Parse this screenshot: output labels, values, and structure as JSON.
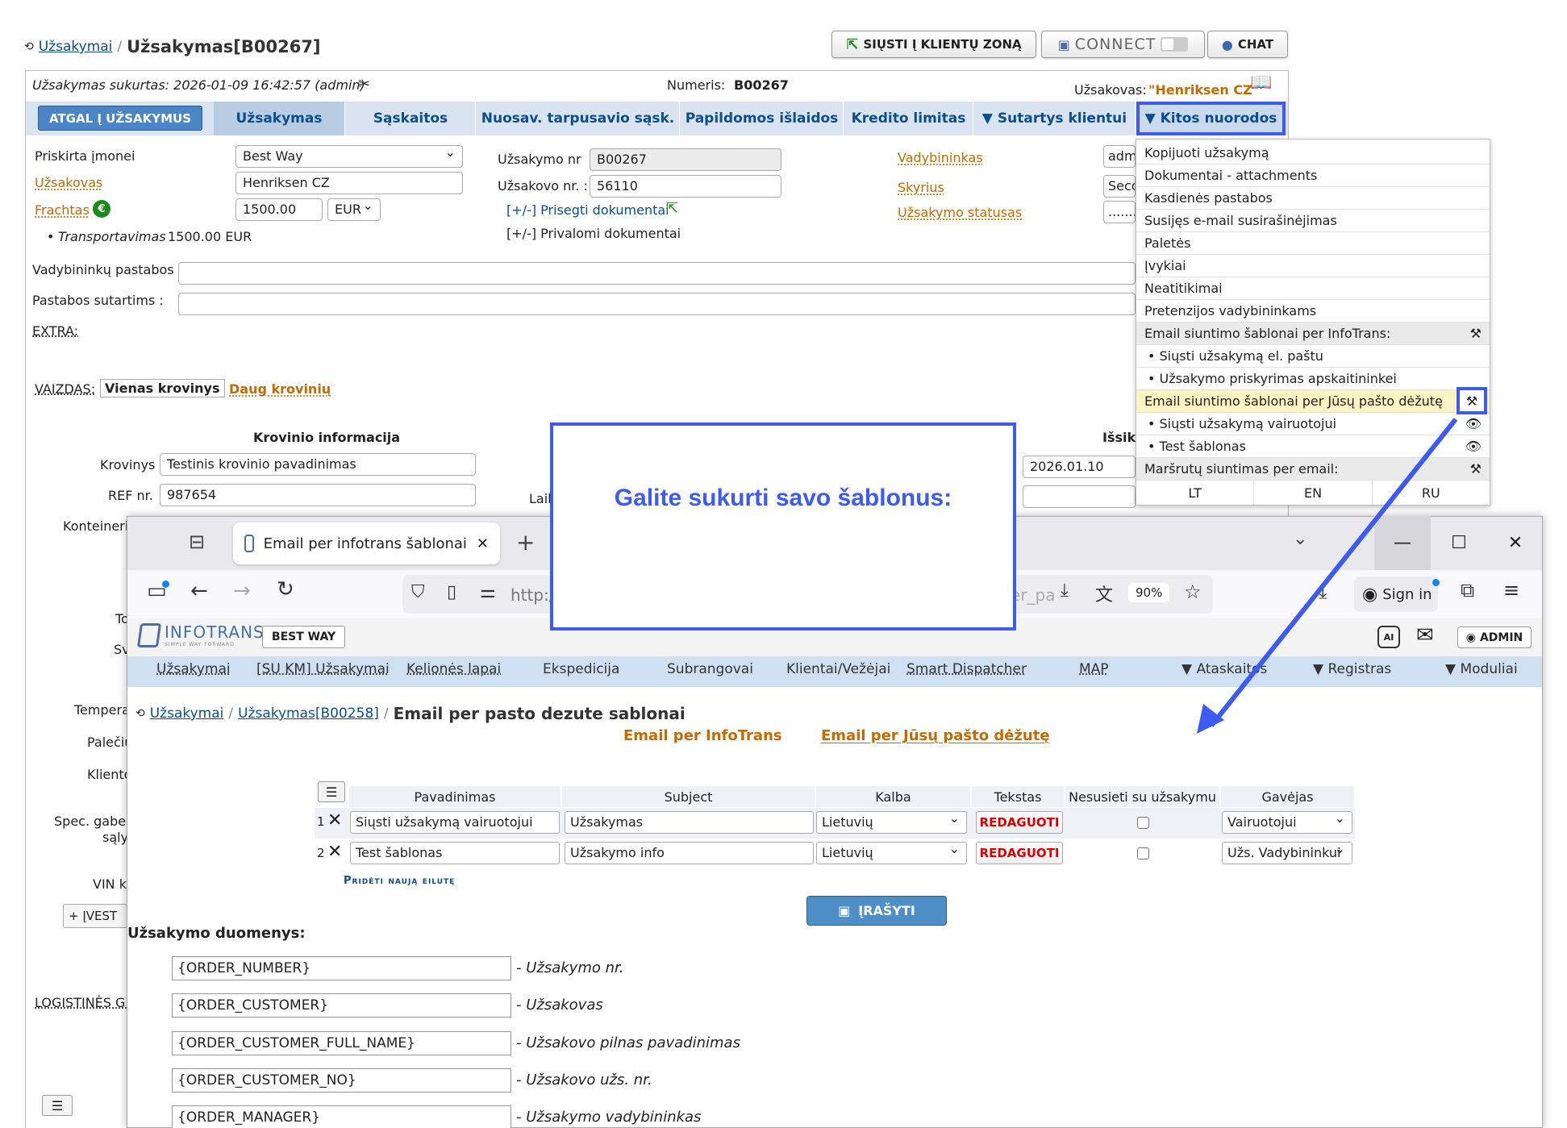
{
  "breadcrumb": {
    "root": "Užsakymai",
    "sep": "/",
    "current": "Užsakymas[B00267]"
  },
  "top_buttons": {
    "send": "SIŲSTI Į KLIENTŲ ZONĄ",
    "connect": "CONNECT",
    "chat": "CHAT"
  },
  "info_bar": {
    "created": "Užsakymas sukurtas: 2026-01-09 16:42:57 (admin)",
    "number_label": "Numeris:",
    "number_value": "B00267",
    "customer_label": "Užsakovas:",
    "customer_value": "\"Henriksen CZ\""
  },
  "tabs": [
    "ATGAL Į UŽSAKYMUS",
    "Užsakymas",
    "Sąskaitos",
    "Nuosav. tarpusavio sąsk.",
    "Papildomos išlaidos",
    "Kredito limitas",
    "▼ Sutartys klientui",
    "▼ Kitos nuorodos"
  ],
  "form": {
    "assigned_label": "Priskirta įmonei",
    "assigned_value": "Best Way",
    "customer_label": "Užsakovas",
    "customer_value": "Henriksen CZ",
    "freight_label": "Frachtas",
    "freight_value": "1500.00",
    "currency": "EUR",
    "transport_label": "Transportavimas",
    "transport_value": "1500.00 EUR",
    "order_nr_label": "Užsakymo nr",
    "order_nr_value": "B00267",
    "cust_nr_label": "Užsakovo nr. :",
    "cust_nr_value": "56110",
    "attach_docs": "[+/-] Prisegti dokumentai",
    "required_docs": "[+/-] Privalomi dokumentai",
    "manager_label": "Vadybininkas",
    "manager_value": "adm",
    "dept_label": "Skyrius",
    "dept_value": "Seco",
    "status_label": "Užsakymo statusas",
    "status_value": "........",
    "mgr_notes_label": "Vadybininkų pastabos :",
    "contract_notes_label": "Pastabos sutartims :",
    "extra_label": "EXTRA:",
    "view_label": "VAIZDAS:",
    "view_single": "Vienas krovinys",
    "view_multi": "Daug krovinių",
    "cargo_header": "Krovinio informacija",
    "cargo_label": "Krovinys",
    "cargo_value": "Testinis krovinio pavadinimas",
    "ref_label": "REF nr.",
    "ref_value": "987654",
    "container_label": "Konteineri",
    "unload_header": "Išsik",
    "unload_date": "2026.01.10",
    "lail": "Lail",
    "side_labels": [
      "To",
      "Sv",
      "Tempera",
      "Palečiu",
      "Kliento",
      "Spec. gaber",
      "sąly",
      "VIN k"
    ],
    "enter_button": "+ ĮVEST",
    "logistics_label": "LOGISTINĖS GI"
  },
  "dropdown": {
    "items": [
      "Kopijuoti užsakymą",
      "Dokumentai - attachments",
      "Kasdienės pastabos",
      "Susijęs e-mail susirašinėjimas",
      "Paletės",
      "Įvykiai",
      "Neatitikimai",
      "Pretenzijos vadybininkams"
    ],
    "section1": "Email siuntimo šablonai per InfoTrans:",
    "section1_items": [
      "• Siųsti užsakymą el. paštu",
      "• Užsakymo priskyrimas apskaitininkei"
    ],
    "section2": "Email siuntimo šablonai per Jūsų pašto dėžutę",
    "section2_items": [
      "• Siųsti užsakymą vairuotojui",
      "• Test šablonas"
    ],
    "section3": "Maršrutų siuntimas per email:",
    "langs": [
      "LT",
      "EN",
      "RU"
    ]
  },
  "callout": {
    "text": "Galite sukurti savo šablonus:"
  },
  "browser": {
    "tab_title": "Email per infotrans šablonai",
    "url_left": "http:/",
    "url_right": "er_pa",
    "zoom": "90%",
    "sign_in": "Sign in"
  },
  "app": {
    "logo": "INFOTRANS",
    "logo_sub": "SIMPLE WAY FORWARD",
    "company": "BEST WAY",
    "admin": "ADMIN",
    "nav": [
      "Užsakymai",
      "[SU KM] Užsakymai",
      "Kelionės lapai",
      "Ekspedicija",
      "Subrangovai",
      "Klientai/Vežėjai",
      "Smart Dispatcher",
      "MAP",
      "▼ Ataskaitos",
      "▼ Registras",
      "▼ Moduliai"
    ],
    "breadcrumb": {
      "root": "Užsakymai",
      "mid": "Užsakymas[B00258]",
      "current": "Email per pasto dezute sablonai"
    },
    "switch_a": "Email per InfoTrans",
    "switch_b": "Email per Jūsų pašto dėžutę",
    "table_headers": [
      "Pavadinimas",
      "Subject",
      "Kalba",
      "Tekstas",
      "Nesusieti su užsakymu",
      "Gavėjas"
    ],
    "rows": [
      {
        "n": "1",
        "name": "Siųsti užsakymą vairuotojui",
        "subject": "Užsakymas",
        "lang": "Lietuvių",
        "edit": "REDAGUOTI",
        "recipient": "Vairuotojui"
      },
      {
        "n": "2",
        "name": "Test šablonas",
        "subject": "Užsakymo info",
        "lang": "Lietuvių",
        "edit": "REDAGUOTI",
        "recipient": "Užs. Vadybininkui"
      }
    ],
    "add_row": "Pridėti naują eilutę",
    "save": "ĮRAŠYTI",
    "order_data_title": "Užsakymo duomenys:",
    "placeholders": [
      {
        "code": "{ORDER_NUMBER}",
        "desc": "- Užsakymo nr."
      },
      {
        "code": "{ORDER_CUSTOMER}",
        "desc": "- Užsakovas"
      },
      {
        "code": "{ORDER_CUSTOMER_FULL_NAME}",
        "desc": "- Užsakovo pilnas pavadinimas"
      },
      {
        "code": "{ORDER_CUSTOMER_NO}",
        "desc": "- Užsakovo užs. nr."
      },
      {
        "code": "{ORDER_MANAGER}",
        "desc": "- Užsakymo vadybininkas"
      }
    ]
  },
  "colors": {
    "accent_blue": "#3d5af1",
    "tab_blue": "#0a4e8c",
    "orange_link": "#c56a00",
    "nav_bg": "#cfe0f3",
    "save_btn": "#4f8fc8"
  }
}
